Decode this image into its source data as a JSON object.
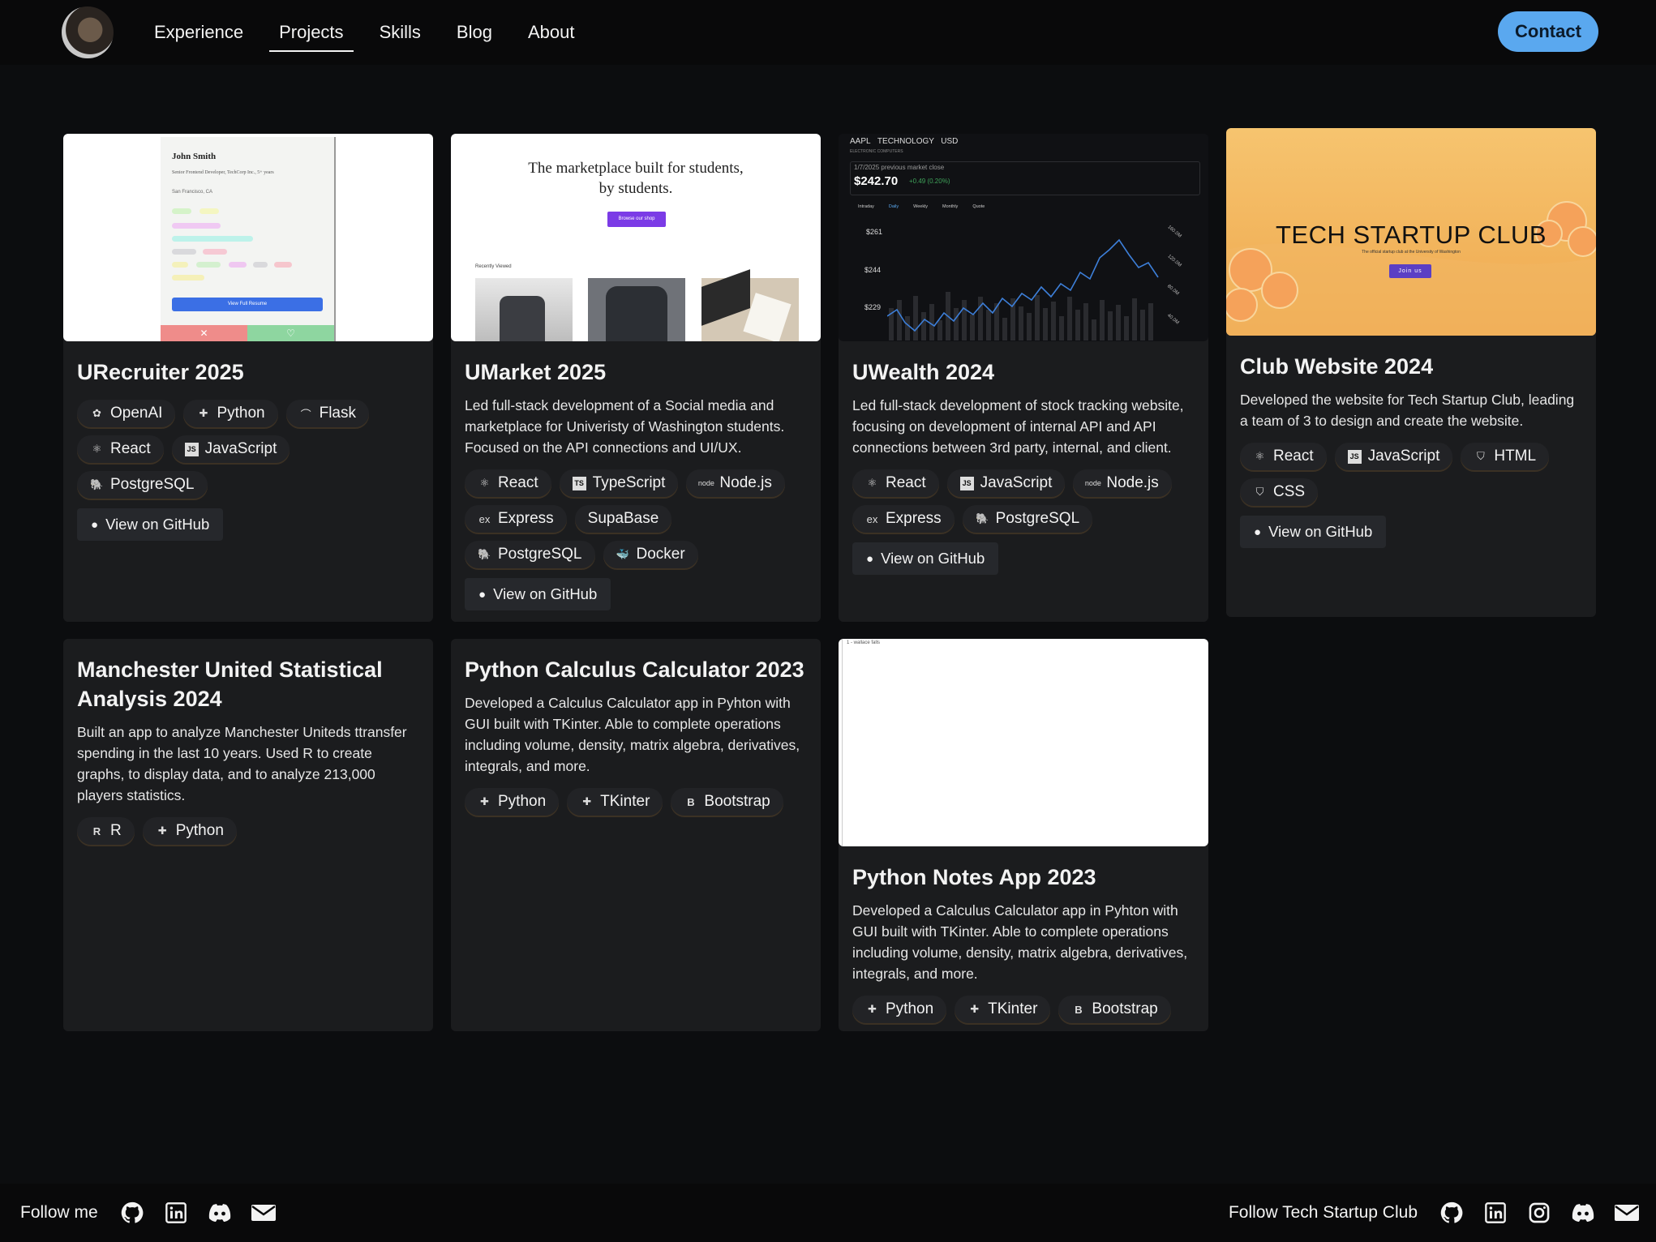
{
  "nav": {
    "items": [
      "Experience",
      "Projects",
      "Skills",
      "Blog",
      "About"
    ],
    "active": "Projects",
    "contact_label": "Contact"
  },
  "projects": [
    {
      "title": "URecruiter 2025",
      "description": "",
      "tags": [
        "OpenAI",
        "Python",
        "Flask",
        "React",
        "JavaScript",
        "PostgreSQL"
      ],
      "github_label": "View on GitHub",
      "thumb": {
        "name": "John Smith",
        "subtitle": "Senior Frontend Developer, TechCorp Inc., 5+ years",
        "location": "San Francisco, CA",
        "button": "View Full Resume"
      }
    },
    {
      "title": "UMarket 2025",
      "description": "Led full-stack development of a Social media and marketplace for Univeristy of Washington students. Focused on the API connections and UI/UX.",
      "tags": [
        "React",
        "TypeScript",
        "Node.js",
        "Express",
        "SupaBase",
        "PostgreSQL",
        "Docker"
      ],
      "github_label": "View on GitHub",
      "thumb": {
        "headline1": "The marketplace built for students,",
        "headline2": "by students.",
        "button": "Browse our shop",
        "section": "Recently Viewed"
      }
    },
    {
      "title": "UWealth 2024",
      "description": "Led full-stack development of stock tracking website, focusing on development of internal API and API connections between 3rd party, internal, and client.",
      "tags": [
        "React",
        "JavaScript",
        "Node.js",
        "Express",
        "PostgreSQL"
      ],
      "github_label": "View on GitHub",
      "thumb": {
        "ticker": "AAPL",
        "sector": "TECHNOLOGY",
        "currency": "USD",
        "sub": "ELECTRONIC COMPUTERS",
        "close_label": "1/7/2025 previous market close",
        "price": "$242.70",
        "change": "+0.49 (0.20%)",
        "tabs": [
          "Intraday",
          "Daily",
          "Weekly",
          "Monthly",
          "Quote"
        ],
        "yticks": [
          "$261",
          "$244",
          "$229"
        ],
        "vticks": [
          "160.0M",
          "120.0M",
          "80.0M",
          "40.0M"
        ]
      }
    },
    {
      "title": "Club Website 2024",
      "description": "Developed the website for Tech Startup Club, leading a team of 3 to design and create the website.",
      "tags": [
        "React",
        "JavaScript",
        "HTML",
        "CSS"
      ],
      "github_label": "View on GitHub",
      "thumb": {
        "headline": "TECH STARTUP CLUB",
        "sub": "The official startup club at the University of Washington",
        "button": "Join us"
      }
    },
    {
      "title": "Manchester United Statistical Analysis 2024",
      "description": "Built an app to analyze Manchester Uniteds ttransfer spending in the last 10 years. Used R to create graphs, to display data, and to analyze 213,000 players statistics.",
      "tags": [
        "R",
        "Python"
      ]
    },
    {
      "title": "Python Calculus Calculator 2023",
      "description": "Developed a Calculus Calculator app in Pyhton with GUI built with TKinter. Able to complete operations including volume, density, matrix algebra, derivatives, integrals, and more.",
      "tags": [
        "Python",
        "TKinter",
        "Bootstrap"
      ]
    },
    {
      "title": "Python Notes App 2023",
      "description": "Developed a Calculus Calculator app in Pyhton with GUI built with TKinter. Able to complete operations including volume, density, matrix algebra, derivatives, integrals, and more.",
      "tags": [
        "Python",
        "TKinter",
        "Bootstrap"
      ],
      "thumb": {
        "caption": "1 - wallace falls"
      }
    }
  ],
  "footer": {
    "left_label": "Follow me",
    "left_icons": [
      "github-icon",
      "linkedin-icon",
      "discord-icon",
      "email-icon"
    ],
    "right_label": "Follow Tech Startup Club",
    "right_icons": [
      "github-icon",
      "linkedin-icon",
      "instagram-icon",
      "discord-icon",
      "email-icon"
    ]
  },
  "colors": {
    "background": "#0c0d0f",
    "card": "#1b1c1e",
    "accent": "#5aa8ef",
    "tag": "#222326"
  }
}
